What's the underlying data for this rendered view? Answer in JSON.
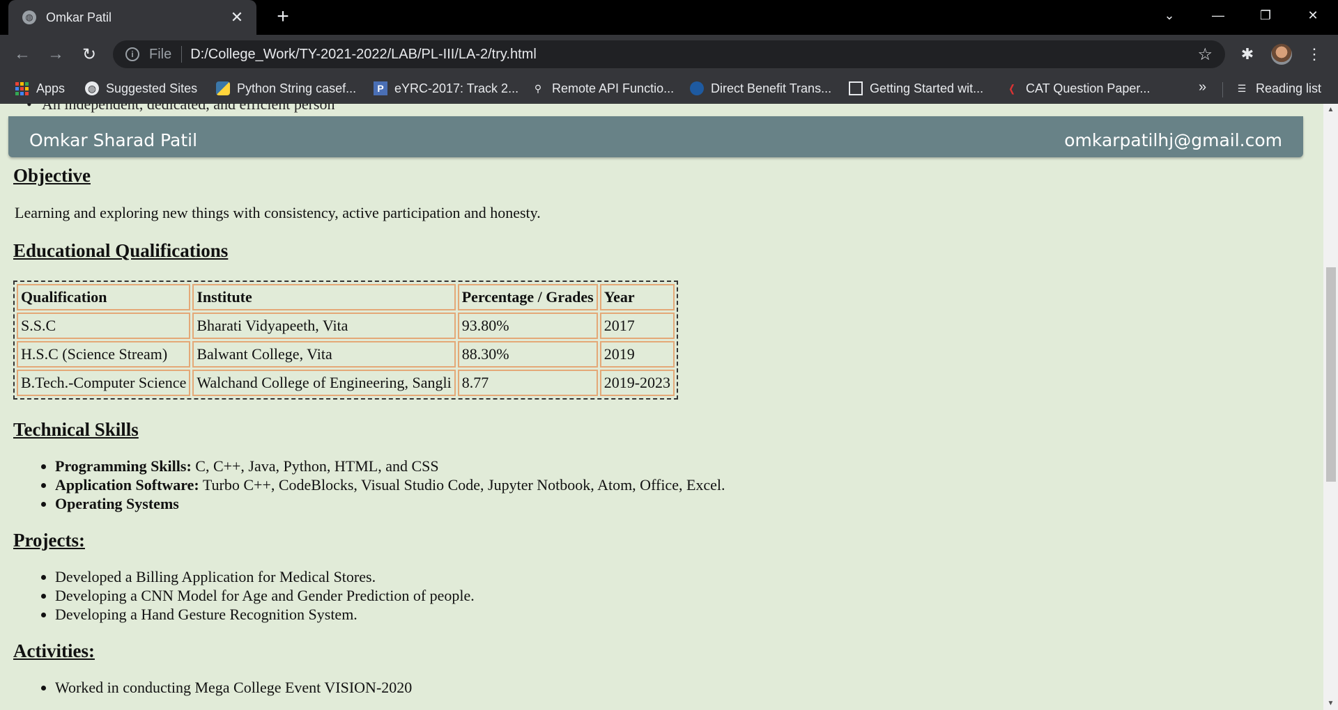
{
  "browser": {
    "tab_title": "Omkar Patil",
    "url_scheme": "File",
    "url": "D:/College_Work/TY-2021-2022/LAB/PL-III/LA-2/try.html",
    "bookmarks": [
      {
        "label": "Apps",
        "icon": "apps-grid-icon"
      },
      {
        "label": "Suggested Sites",
        "icon": "globe-icon"
      },
      {
        "label": "Python String casef...",
        "icon": "python-icon"
      },
      {
        "label": "eYRC-2017: Track 2...",
        "icon": "p-icon"
      },
      {
        "label": "Remote API Functio...",
        "icon": "robot-icon"
      },
      {
        "label": "Direct Benefit Trans...",
        "icon": "dbt-icon"
      },
      {
        "label": "Getting Started wit...",
        "icon": "doc-icon"
      },
      {
        "label": "CAT Question Paper...",
        "icon": "cat-icon"
      }
    ],
    "bookmarks_more": "»",
    "reading_list": "Reading list"
  },
  "page": {
    "cut_line": "An independent, dedicated, and efficient person",
    "header": {
      "name": "Omkar Sharad Patil",
      "email": "omkarpatilhj@gmail.com"
    },
    "objective": {
      "heading": "Objective",
      "text": "Learning and exploring new things with consistency, active participation and honesty."
    },
    "education": {
      "heading": "Educational Qualifications",
      "columns": [
        "Qualification",
        "Institute",
        "Percentage / Grades",
        "Year"
      ],
      "rows": [
        [
          "S.S.C",
          "Bharati Vidyapeeth, Vita",
          "93.80%",
          "2017"
        ],
        [
          "H.S.C (Science Stream)",
          "Balwant College, Vita",
          "88.30%",
          "2019"
        ],
        [
          "B.Tech.-Computer Science",
          "Walchand College of Engineering, Sangli",
          "8.77",
          "2019-2023"
        ]
      ]
    },
    "skills": {
      "heading": "Technical Skills",
      "items": [
        {
          "label": "Programming Skills:",
          "value": " C, C++, Java, Python, HTML, and CSS"
        },
        {
          "label": "Application Software:",
          "value": " Turbo C++, CodeBlocks, Visual Studio Code, Jupyter Notbook, Atom, Office, Excel."
        },
        {
          "label": "Operating Systems",
          "value": ""
        }
      ]
    },
    "projects": {
      "heading": "Projects:",
      "items": [
        "Developed a Billing Application for Medical Stores.",
        "Developing a CNN Model for Age and Gender Prediction of people.",
        "Developing a Hand Gesture Recognition System."
      ]
    },
    "activities": {
      "heading": "Activities:",
      "items": [
        "Worked in conducting Mega College Event VISION-2020"
      ]
    }
  }
}
